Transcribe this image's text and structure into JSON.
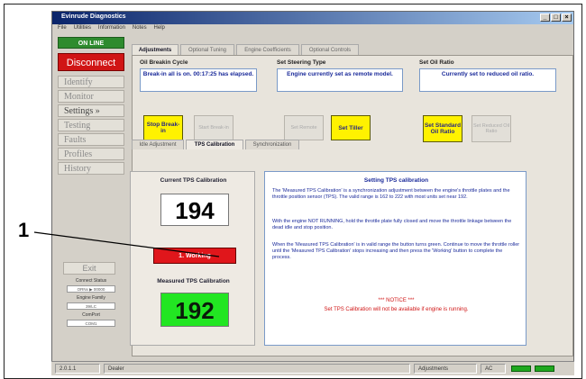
{
  "window": {
    "title": "Evinrude Diagnostics",
    "controls": [
      "_",
      "□",
      "×"
    ]
  },
  "menu": [
    "File",
    "Utilities",
    "Information",
    "Notes",
    "Help"
  ],
  "sidebar": {
    "online_label": "ON LINE",
    "disconnect_label": "Disconnect",
    "items": [
      "Identify",
      "Monitor",
      "Settings »",
      "Testing",
      "Faults",
      "Profiles",
      "History"
    ],
    "exit_label": "Exit",
    "connect_status_label": "Connect Status",
    "connect_status_value": "ORNx ▶ 00000",
    "engine_family_label": "Engine Family",
    "engine_family_value": "39/LC",
    "comm_label": "ComPort",
    "comm_value": "COM1"
  },
  "tabs": [
    "Adjustments",
    "Optional Tuning",
    "Engine Coefficients",
    "Optional Controls"
  ],
  "groups": {
    "oil_breakin": {
      "title": "Oil Breakin Cycle",
      "info": "Break-in all is on. 00:17:25 has elapsed.",
      "btn_stop": "Stop Break-in",
      "btn_start": "Start Break-in"
    },
    "steering": {
      "title": "Set Steering Type",
      "info": "Engine currently set as remote model.",
      "btn_remote": "Set Remote",
      "btn_tiller": "Set Tiller"
    },
    "oil_ratio": {
      "title": "Set Oil Ratio",
      "info": "Currently set to reduced oil ratio.",
      "btn_standard": "Set Standard Oil Ratio",
      "btn_reduced": "Set Reduced Oil Ratio"
    }
  },
  "subtabs": [
    "Idle Adjustment",
    "TPS Calibration",
    "Synchronization"
  ],
  "tps": {
    "current_label": "Current TPS Calibration",
    "current_value": "194",
    "working_button": "1. Working",
    "measured_label": "Measured TPS Calibration",
    "measured_value": "192",
    "measured_color": "#22e622"
  },
  "help": {
    "title": "Setting TPS calibration",
    "p1": "The 'Measured TPS Calibration' is a synchronization adjustment between the engine's throttle plates and the throttle position sensor (TPS). The valid range is 162 to 222 with most units set near 192.",
    "p2": "With the engine NOT RUNNING, hold the throttle plate fully closed and move the throttle linkage between the dead idle and stop position.",
    "p3": "When the 'Measured TPS Calibration' is in valid range the button turns green. Continue to move the throttle roller until the 'Measured TPS Calibration' stops increasing and then press the 'Working' button to complete the process.",
    "notice": "*** NOTICE ***",
    "warning": "Set TPS Calibration will not be available if engine is running."
  },
  "callout": {
    "number": "1"
  },
  "statusbar": {
    "version": "2.0.1.1",
    "mode": "Dealer",
    "section": "Adjustments",
    "power": "AC"
  },
  "colors": {
    "online": "#2e8b2e",
    "disconnect": "#d01515",
    "working": "#e0161b",
    "highlight": "#fff200"
  }
}
